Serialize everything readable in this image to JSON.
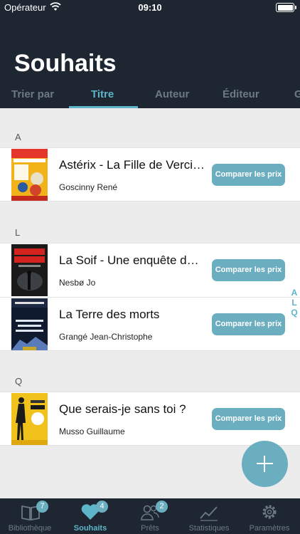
{
  "status_bar": {
    "carrier": "Opérateur",
    "time": "09:10"
  },
  "header": {
    "title": "Souhaits"
  },
  "sort_tabs": [
    {
      "label": "Trier par",
      "active": false
    },
    {
      "label": "Titre",
      "active": true
    },
    {
      "label": "Auteur",
      "active": false
    },
    {
      "label": "Éditeur",
      "active": false
    },
    {
      "label": "G",
      "active": false
    }
  ],
  "sections": [
    {
      "letter": "A",
      "books": [
        {
          "title": "Astérix - La Fille de Vercingétorix",
          "author": "Goscinny René",
          "cover_text": "NOUVEL ALBUM"
        }
      ]
    },
    {
      "letter": "L",
      "books": [
        {
          "title": "La Soif - Une enquête de l'inspecteur Harry Hole",
          "author": "Nesbø Jo",
          "cover_text": "JO NESBØ"
        },
        {
          "title": "La Terre des morts",
          "author": "Grangé Jean-Christophe",
          "cover_text": "GRANGÉ"
        }
      ]
    },
    {
      "letter": "Q",
      "books": [
        {
          "title": "Que serais-je sans toi ?",
          "author": "Musso Guillaume",
          "cover_text": "GUILLAUME MUSSO"
        }
      ]
    }
  ],
  "compare_label": "Comparer les prix",
  "index_letters": [
    "A",
    "L",
    "Q"
  ],
  "tab_bar": {
    "library": {
      "label": "Bibliothèque",
      "badge": "7"
    },
    "wishlist": {
      "label": "Souhaits",
      "badge": "4"
    },
    "loans": {
      "label": "Prêts",
      "badge": "2"
    },
    "stats": {
      "label": "Statistiques"
    },
    "settings": {
      "label": "Paramètres"
    }
  },
  "colors": {
    "header_bg": "#1e2731",
    "accent": "#5eb4c9",
    "button": "#6aaec0",
    "inactive": "#6b7987"
  }
}
